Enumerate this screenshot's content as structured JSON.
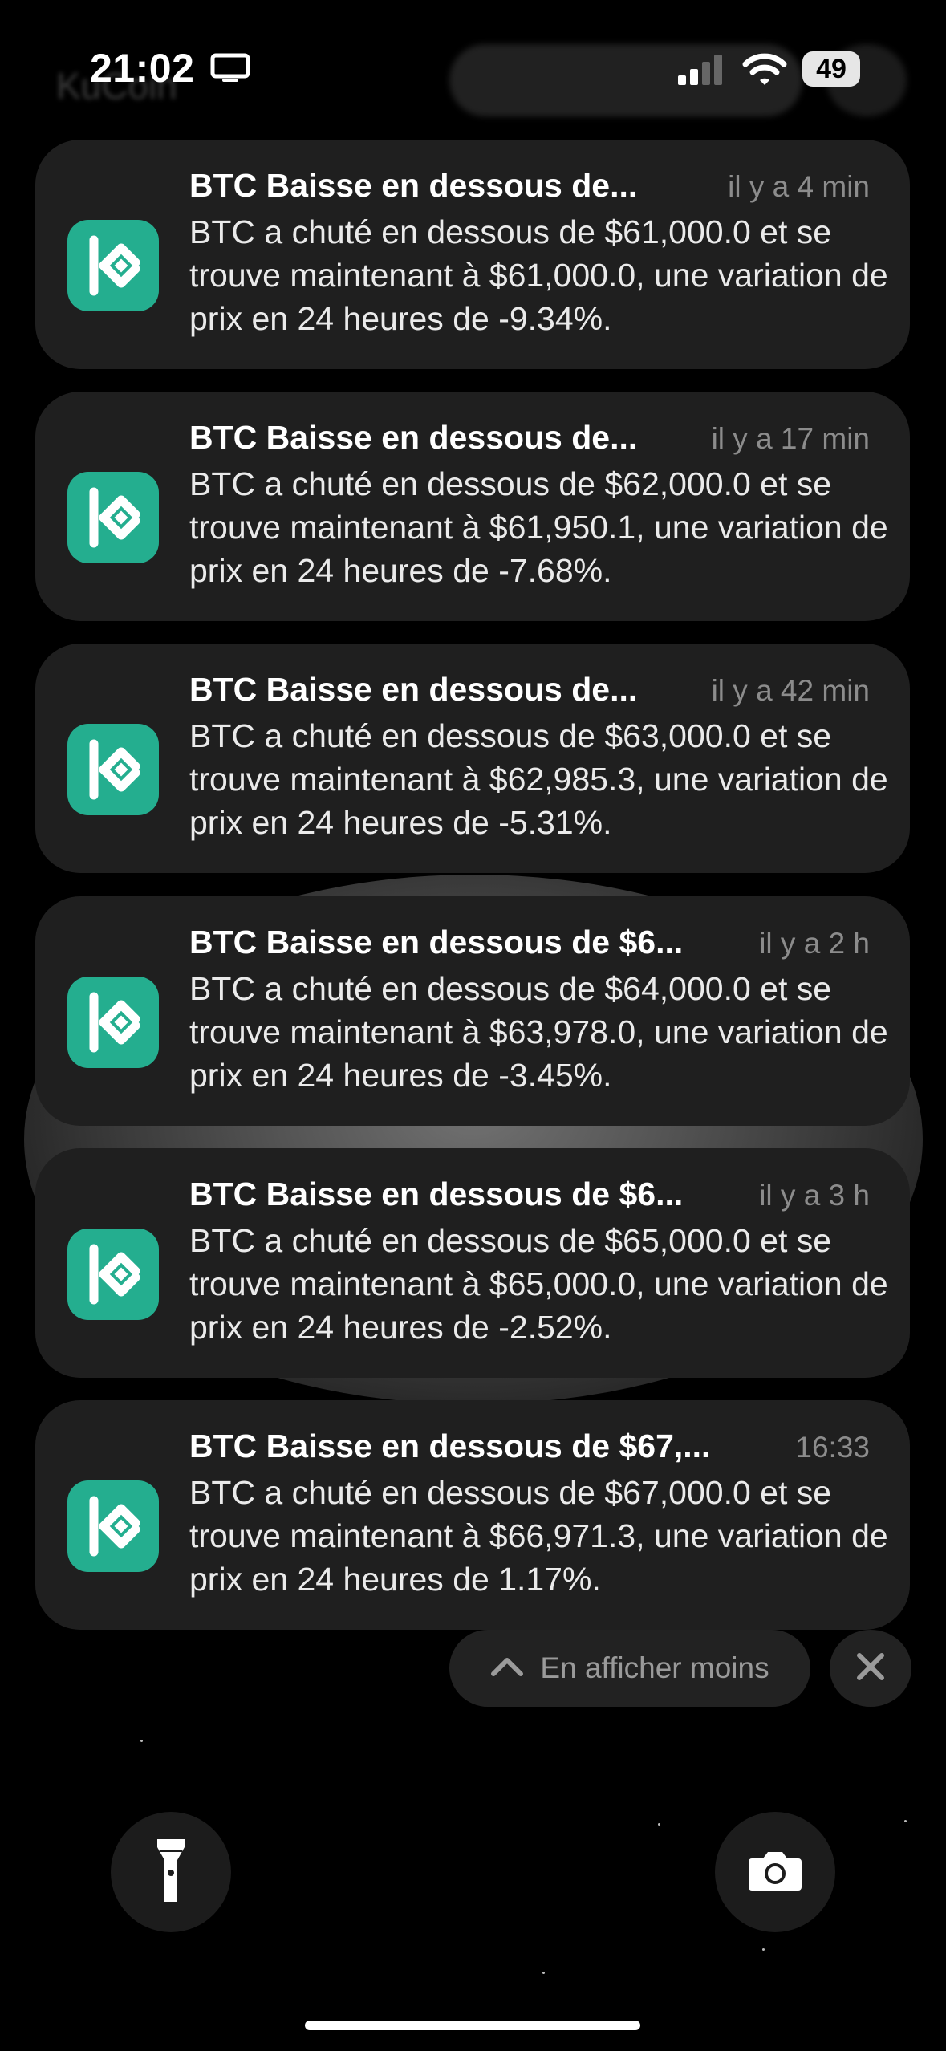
{
  "status_bar": {
    "time": "21:02",
    "battery": "49"
  },
  "background_title": "KuCoin",
  "notifications": [
    {
      "title": "BTC Baisse en dessous de...",
      "time": "il y a 4 min",
      "body": "BTC a chuté en dessous de $61,000.0 et se trouve maintenant à $61,000.0, une variation de prix en 24 heures de -9.34%."
    },
    {
      "title": "BTC Baisse en dessous de...",
      "time": "il y a 17 min",
      "body": "BTC a chuté en dessous de $62,000.0 et se trouve maintenant à $61,950.1, une variation de prix en 24 heures de -7.68%."
    },
    {
      "title": "BTC Baisse en dessous de...",
      "time": "il y a 42 min",
      "body": "BTC a chuté en dessous de $63,000.0 et se trouve maintenant à $62,985.3, une variation de prix en 24 heures de -5.31%."
    },
    {
      "title": "BTC Baisse en dessous de $6...",
      "time": "il y a 2 h",
      "body": "BTC a chuté en dessous de $64,000.0 et se trouve maintenant à $63,978.0, une variation de prix en 24 heures de -3.45%."
    },
    {
      "title": "BTC Baisse en dessous de $6...",
      "time": "il y a 3 h",
      "body": "BTC a chuté en dessous de $65,000.0 et se trouve maintenant à $65,000.0, une variation de prix en 24 heures de -2.52%."
    },
    {
      "title": "BTC Baisse en dessous de $67,...",
      "time": "16:33",
      "body": "BTC a chuté en dessous de $67,000.0 et se trouve maintenant à $66,971.3, une variation de prix en 24 heures de 1.17%."
    }
  ],
  "controls": {
    "show_less_label": "En afficher moins"
  },
  "icons": {
    "app": "kucoin-logo-icon",
    "flashlight": "flashlight-icon",
    "camera": "camera-icon",
    "close": "close-icon",
    "chevron": "chevron-up-icon"
  },
  "colors": {
    "app_accent": "#24ae8f",
    "card": "#1f1f1f"
  }
}
